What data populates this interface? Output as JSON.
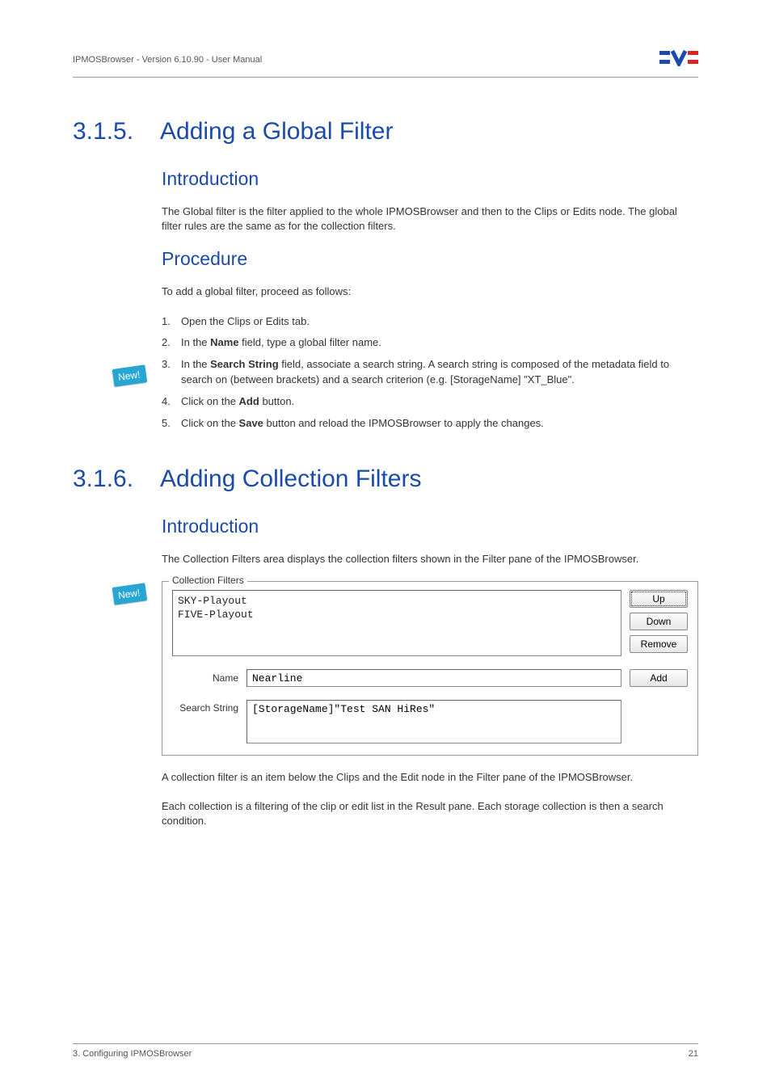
{
  "header": {
    "left": "IPMOSBrowser - Version 6.10.90 - User Manual"
  },
  "sections": {
    "s315": {
      "number": "3.1.5.",
      "title": "Adding a Global Filter",
      "intro_heading": "Introduction",
      "intro_text": "The Global filter is the filter applied to the whole IPMOSBrowser and then to the Clips or Edits node. The global filter rules are the same as for the collection filters.",
      "proc_heading": "Procedure",
      "proc_lead": "To add a global filter, proceed as follows:",
      "steps": [
        "Open the Clips or Edits tab.",
        "In the Name field, type a global filter name.",
        "In the Search String field, associate a search string. A search string is composed of the metadata field to search on (between brackets) and a search criterion (e.g. [StorageName] \"XT_Blue\".",
        "Click on the Add button.",
        "Click on the Save button and reload the IPMOSBrowser to apply the changes."
      ],
      "step2_bold": "Name",
      "step3_bold": "Search String",
      "step4_bold": "Add",
      "step5_bold": "Save"
    },
    "s316": {
      "number": "3.1.6.",
      "title": "Adding Collection Filters",
      "intro_heading": "Introduction",
      "intro_text": "The Collection Filters area displays the collection filters shown in the Filter pane of the IPMOSBrowser.",
      "after_text1": "A collection filter is an item below the Clips and the Edit node in the Filter pane of the IPMOSBrowser.",
      "after_text2": "Each collection is a filtering of the clip or edit list in the Result pane. Each storage collection is then a search condition."
    }
  },
  "badge": {
    "label": "New!"
  },
  "collection_filters": {
    "legend": "Collection Filters",
    "list_items": [
      "SKY-Playout",
      "FIVE-Playout"
    ],
    "buttons": {
      "up": "Up",
      "down": "Down",
      "remove": "Remove",
      "add": "Add"
    },
    "name_label": "Name",
    "name_value": "Nearline",
    "search_label": "Search String",
    "search_value": "[StorageName]\"Test SAN HiRes\""
  },
  "footer": {
    "left": "3. Configuring IPMOSBrowser",
    "right": "21"
  }
}
